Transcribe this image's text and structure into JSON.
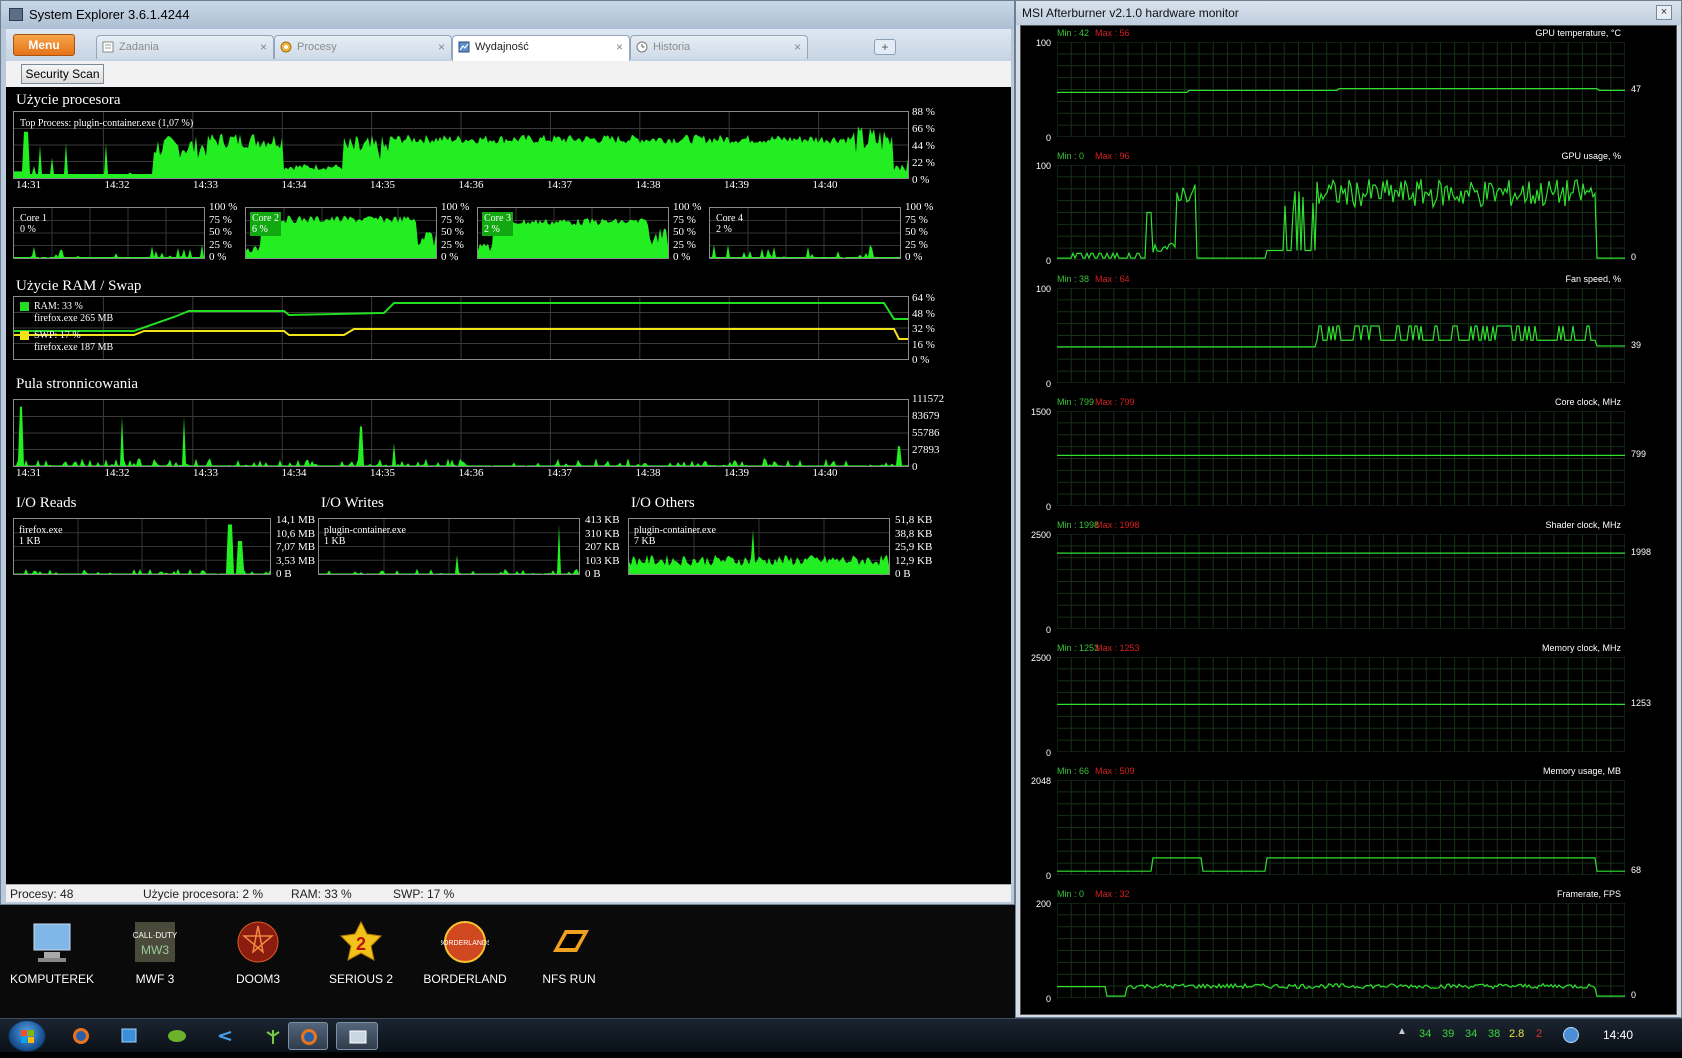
{
  "se": {
    "title": "System Explorer 3.6.1.4244",
    "menu": "Menu",
    "tabs": [
      {
        "label": "Zadania",
        "icon": "tasks-icon"
      },
      {
        "label": "Procesy",
        "icon": "processes-icon"
      },
      {
        "label": "Wydajność",
        "icon": "performance-icon"
      },
      {
        "label": "Historia",
        "icon": "history-icon"
      }
    ],
    "close_glyph": "×",
    "new_tab_glyph": "+",
    "security_scan": "Security Scan",
    "cpu": {
      "title": "Użycie procesora",
      "top_process": "Top Process: plugin-container.exe (1,07 %)",
      "y_labels": [
        "88 %",
        "66 %",
        "44 %",
        "22 %",
        "0 %"
      ],
      "times": [
        "14:31",
        "14:32",
        "14:33",
        "14:34",
        "14:35",
        "14:36",
        "14:37",
        "14:38",
        "14:39",
        "14:40"
      ],
      "cores": [
        {
          "name": "Core 1",
          "value": "0 %",
          "level": 0.04
        },
        {
          "name": "Core 2",
          "value": "6 %",
          "level": 0.85
        },
        {
          "name": "Core 3",
          "value": "2 %",
          "level": 0.8
        },
        {
          "name": "Core 4",
          "value": "2 %",
          "level": 0.04
        }
      ],
      "core_y_labels": [
        "100 %",
        "75 %",
        "50 %",
        "25 %",
        "0 %"
      ]
    },
    "ram": {
      "title": "Użycie RAM / Swap",
      "ram_label": "RAM: 33 %",
      "ram_proc": "firefox.exe 265 MB",
      "swp_label": "SWP: 17 %",
      "swp_proc": "firefox.exe 187 MB",
      "y_labels": [
        "64 %",
        "48 %",
        "32 %",
        "16 %",
        "0 %"
      ],
      "ram_color": "#22dd22",
      "swp_color": "#f2e21a"
    },
    "pool": {
      "title": "Pula stronnicowania",
      "y_labels": [
        "111572",
        "83679",
        "55786",
        "27893",
        "0"
      ],
      "times": [
        "14:31",
        "14:32",
        "14:33",
        "14:34",
        "14:35",
        "14:36",
        "14:37",
        "14:38",
        "14:39",
        "14:40"
      ]
    },
    "io": [
      {
        "title": "I/O Reads",
        "proc": "firefox.exe",
        "value": "1 KB",
        "y_labels": [
          "14,1 MB",
          "10,6 MB",
          "7,07 MB",
          "3,53 MB",
          "0 B"
        ]
      },
      {
        "title": "I/O Writes",
        "proc": "plugin-container.exe",
        "value": "1 KB",
        "y_labels": [
          "413 KB",
          "310 KB",
          "207 KB",
          "103 KB",
          "0 B"
        ]
      },
      {
        "title": "I/O Others",
        "proc": "plugin-container.exe",
        "value": "7 KB",
        "y_labels": [
          "51,8 KB",
          "38,8 KB",
          "25,9 KB",
          "12,9 KB",
          "0 B"
        ]
      }
    ],
    "status": {
      "procs": "Procesy: 48",
      "cpu": "Użycie procesora: 2 %",
      "ram": "RAM: 33 %",
      "swp": "SWP: 17 %"
    }
  },
  "msi": {
    "title": "MSI Afterburner v2.1.0 hardware monitor",
    "close_glyph": "×",
    "graphs": [
      {
        "name": "GPU temperature, °C",
        "min": "Min : 42",
        "max": "Max : 56",
        "ytop": "100",
        "ybot": "0",
        "cur": "47"
      },
      {
        "name": "GPU usage, %",
        "min": "Min : 0",
        "max": "Max : 96",
        "ytop": "100",
        "ybot": "0",
        "cur": "0"
      },
      {
        "name": "Fan speed, %",
        "min": "Min : 38",
        "max": "Max : 64",
        "ytop": "100",
        "ybot": "0",
        "cur": "39"
      },
      {
        "name": "Core clock, MHz",
        "min": "Min : 799",
        "max": "Max : 799",
        "ytop": "1500",
        "ybot": "0",
        "cur": "799"
      },
      {
        "name": "Shader clock, MHz",
        "min": "Min : 1998",
        "max": "Max : 1998",
        "ytop": "2500",
        "ybot": "0",
        "cur": "1998"
      },
      {
        "name": "Memory clock, MHz",
        "min": "Min : 1253",
        "max": "Max : 1253",
        "ytop": "2500",
        "ybot": "0",
        "cur": "1253"
      },
      {
        "name": "Memory usage, MB",
        "min": "Min : 66",
        "max": "Max : 509",
        "ytop": "2048",
        "ybot": "0",
        "cur": "68"
      },
      {
        "name": "Framerate, FPS",
        "min": "Min : 0",
        "max": "Max : 32",
        "ytop": "200",
        "ybot": "0",
        "cur": "0"
      }
    ],
    "min_color": "#39c239",
    "max_color": "#d42020",
    "line_color": "#30e030"
  },
  "desktop": {
    "icons": [
      {
        "label": "KOMPUTEREK",
        "icon": "computer-icon"
      },
      {
        "label": "MWF 3",
        "icon": "mw3-icon"
      },
      {
        "label": "DOOM3",
        "icon": "doom3-icon"
      },
      {
        "label": "SERIOUS 2",
        "icon": "serious-sam-icon"
      },
      {
        "label": "BORDERLAND",
        "icon": "borderlands-icon"
      },
      {
        "label": "NFS RUN",
        "icon": "nfs-run-icon"
      }
    ]
  },
  "taskbar": {
    "tray": [
      {
        "text": "34",
        "color": "#3bd63b"
      },
      {
        "text": "39",
        "color": "#3bd63b"
      },
      {
        "text": "34",
        "color": "#3bd63b"
      },
      {
        "text": "38",
        "color": "#3bd63b"
      },
      {
        "text": "2.8",
        "color": "#e8e23a"
      },
      {
        "text": "2",
        "color": "#e03030"
      }
    ],
    "clock": "14:40"
  }
}
